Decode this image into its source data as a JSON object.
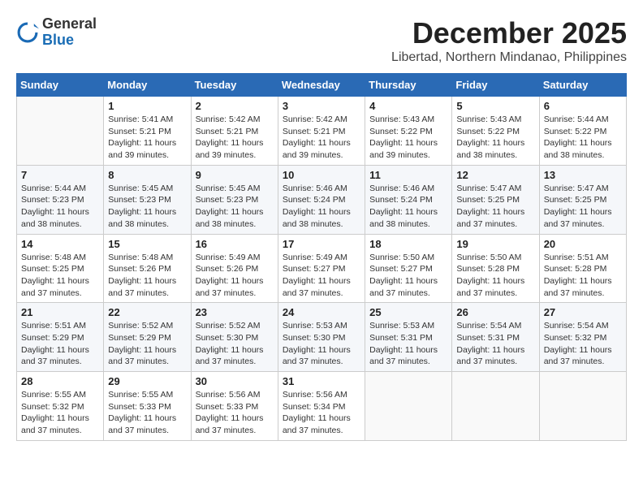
{
  "logo": {
    "general": "General",
    "blue": "Blue"
  },
  "header": {
    "month": "December 2025",
    "location": "Libertad, Northern Mindanao, Philippines"
  },
  "weekdays": [
    "Sunday",
    "Monday",
    "Tuesday",
    "Wednesday",
    "Thursday",
    "Friday",
    "Saturday"
  ],
  "weeks": [
    [
      {
        "day": "",
        "sunrise": "",
        "sunset": "",
        "daylight": ""
      },
      {
        "day": "1",
        "sunrise": "Sunrise: 5:41 AM",
        "sunset": "Sunset: 5:21 PM",
        "daylight": "Daylight: 11 hours and 39 minutes."
      },
      {
        "day": "2",
        "sunrise": "Sunrise: 5:42 AM",
        "sunset": "Sunset: 5:21 PM",
        "daylight": "Daylight: 11 hours and 39 minutes."
      },
      {
        "day": "3",
        "sunrise": "Sunrise: 5:42 AM",
        "sunset": "Sunset: 5:21 PM",
        "daylight": "Daylight: 11 hours and 39 minutes."
      },
      {
        "day": "4",
        "sunrise": "Sunrise: 5:43 AM",
        "sunset": "Sunset: 5:22 PM",
        "daylight": "Daylight: 11 hours and 39 minutes."
      },
      {
        "day": "5",
        "sunrise": "Sunrise: 5:43 AM",
        "sunset": "Sunset: 5:22 PM",
        "daylight": "Daylight: 11 hours and 38 minutes."
      },
      {
        "day": "6",
        "sunrise": "Sunrise: 5:44 AM",
        "sunset": "Sunset: 5:22 PM",
        "daylight": "Daylight: 11 hours and 38 minutes."
      }
    ],
    [
      {
        "day": "7",
        "sunrise": "Sunrise: 5:44 AM",
        "sunset": "Sunset: 5:23 PM",
        "daylight": "Daylight: 11 hours and 38 minutes."
      },
      {
        "day": "8",
        "sunrise": "Sunrise: 5:45 AM",
        "sunset": "Sunset: 5:23 PM",
        "daylight": "Daylight: 11 hours and 38 minutes."
      },
      {
        "day": "9",
        "sunrise": "Sunrise: 5:45 AM",
        "sunset": "Sunset: 5:23 PM",
        "daylight": "Daylight: 11 hours and 38 minutes."
      },
      {
        "day": "10",
        "sunrise": "Sunrise: 5:46 AM",
        "sunset": "Sunset: 5:24 PM",
        "daylight": "Daylight: 11 hours and 38 minutes."
      },
      {
        "day": "11",
        "sunrise": "Sunrise: 5:46 AM",
        "sunset": "Sunset: 5:24 PM",
        "daylight": "Daylight: 11 hours and 38 minutes."
      },
      {
        "day": "12",
        "sunrise": "Sunrise: 5:47 AM",
        "sunset": "Sunset: 5:25 PM",
        "daylight": "Daylight: 11 hours and 37 minutes."
      },
      {
        "day": "13",
        "sunrise": "Sunrise: 5:47 AM",
        "sunset": "Sunset: 5:25 PM",
        "daylight": "Daylight: 11 hours and 37 minutes."
      }
    ],
    [
      {
        "day": "14",
        "sunrise": "Sunrise: 5:48 AM",
        "sunset": "Sunset: 5:25 PM",
        "daylight": "Daylight: 11 hours and 37 minutes."
      },
      {
        "day": "15",
        "sunrise": "Sunrise: 5:48 AM",
        "sunset": "Sunset: 5:26 PM",
        "daylight": "Daylight: 11 hours and 37 minutes."
      },
      {
        "day": "16",
        "sunrise": "Sunrise: 5:49 AM",
        "sunset": "Sunset: 5:26 PM",
        "daylight": "Daylight: 11 hours and 37 minutes."
      },
      {
        "day": "17",
        "sunrise": "Sunrise: 5:49 AM",
        "sunset": "Sunset: 5:27 PM",
        "daylight": "Daylight: 11 hours and 37 minutes."
      },
      {
        "day": "18",
        "sunrise": "Sunrise: 5:50 AM",
        "sunset": "Sunset: 5:27 PM",
        "daylight": "Daylight: 11 hours and 37 minutes."
      },
      {
        "day": "19",
        "sunrise": "Sunrise: 5:50 AM",
        "sunset": "Sunset: 5:28 PM",
        "daylight": "Daylight: 11 hours and 37 minutes."
      },
      {
        "day": "20",
        "sunrise": "Sunrise: 5:51 AM",
        "sunset": "Sunset: 5:28 PM",
        "daylight": "Daylight: 11 hours and 37 minutes."
      }
    ],
    [
      {
        "day": "21",
        "sunrise": "Sunrise: 5:51 AM",
        "sunset": "Sunset: 5:29 PM",
        "daylight": "Daylight: 11 hours and 37 minutes."
      },
      {
        "day": "22",
        "sunrise": "Sunrise: 5:52 AM",
        "sunset": "Sunset: 5:29 PM",
        "daylight": "Daylight: 11 hours and 37 minutes."
      },
      {
        "day": "23",
        "sunrise": "Sunrise: 5:52 AM",
        "sunset": "Sunset: 5:30 PM",
        "daylight": "Daylight: 11 hours and 37 minutes."
      },
      {
        "day": "24",
        "sunrise": "Sunrise: 5:53 AM",
        "sunset": "Sunset: 5:30 PM",
        "daylight": "Daylight: 11 hours and 37 minutes."
      },
      {
        "day": "25",
        "sunrise": "Sunrise: 5:53 AM",
        "sunset": "Sunset: 5:31 PM",
        "daylight": "Daylight: 11 hours and 37 minutes."
      },
      {
        "day": "26",
        "sunrise": "Sunrise: 5:54 AM",
        "sunset": "Sunset: 5:31 PM",
        "daylight": "Daylight: 11 hours and 37 minutes."
      },
      {
        "day": "27",
        "sunrise": "Sunrise: 5:54 AM",
        "sunset": "Sunset: 5:32 PM",
        "daylight": "Daylight: 11 hours and 37 minutes."
      }
    ],
    [
      {
        "day": "28",
        "sunrise": "Sunrise: 5:55 AM",
        "sunset": "Sunset: 5:32 PM",
        "daylight": "Daylight: 11 hours and 37 minutes."
      },
      {
        "day": "29",
        "sunrise": "Sunrise: 5:55 AM",
        "sunset": "Sunset: 5:33 PM",
        "daylight": "Daylight: 11 hours and 37 minutes."
      },
      {
        "day": "30",
        "sunrise": "Sunrise: 5:56 AM",
        "sunset": "Sunset: 5:33 PM",
        "daylight": "Daylight: 11 hours and 37 minutes."
      },
      {
        "day": "31",
        "sunrise": "Sunrise: 5:56 AM",
        "sunset": "Sunset: 5:34 PM",
        "daylight": "Daylight: 11 hours and 37 minutes."
      },
      {
        "day": "",
        "sunrise": "",
        "sunset": "",
        "daylight": ""
      },
      {
        "day": "",
        "sunrise": "",
        "sunset": "",
        "daylight": ""
      },
      {
        "day": "",
        "sunrise": "",
        "sunset": "",
        "daylight": ""
      }
    ]
  ]
}
